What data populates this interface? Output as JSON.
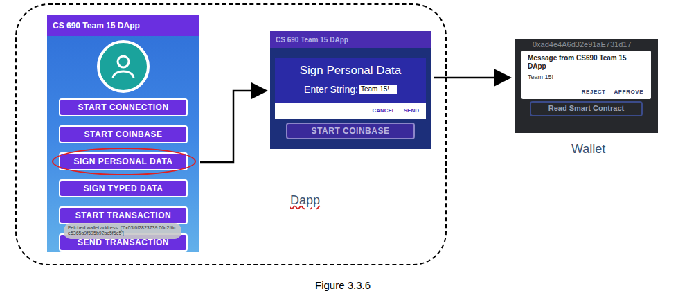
{
  "figure": {
    "caption": "Figure 3.3.6"
  },
  "dapp": {
    "label": "Dapp",
    "phone": {
      "title": "CS 690 Team 15 DApp",
      "buttons": [
        {
          "label": "START CONNECTION",
          "selected": false
        },
        {
          "label": "START COINBASE",
          "selected": false
        },
        {
          "label": "SIGN PERSONAL DATA",
          "selected": true
        },
        {
          "label": "SIGN TYPED DATA",
          "selected": false
        },
        {
          "label": "START TRANSACTION",
          "selected": false
        },
        {
          "label": "SEND TRANSACTION",
          "selected": false
        }
      ],
      "toast": "Fetched wallet address: ['0x03f6f2823739 00c2f6ce5365a9f595b92ac5f5e5']"
    },
    "dialog": {
      "app_title": "CS 690 Team 15 DApp",
      "title": "Sign Personal Data",
      "field_label": "Enter String:",
      "field_value": "Team 15!",
      "buttons": [
        "CANCEL",
        "SEND"
      ],
      "background_button": "START COINBASE"
    }
  },
  "wallet": {
    "label": "Wallet",
    "address": "0xad4e4A6d32e91aE731d17",
    "message_title": "Message from CS690 Team 15 DApp",
    "message": "Team 15!",
    "buttons": [
      "REJECT",
      "APPROVE"
    ],
    "background_button": "Read Smart Contract"
  }
}
